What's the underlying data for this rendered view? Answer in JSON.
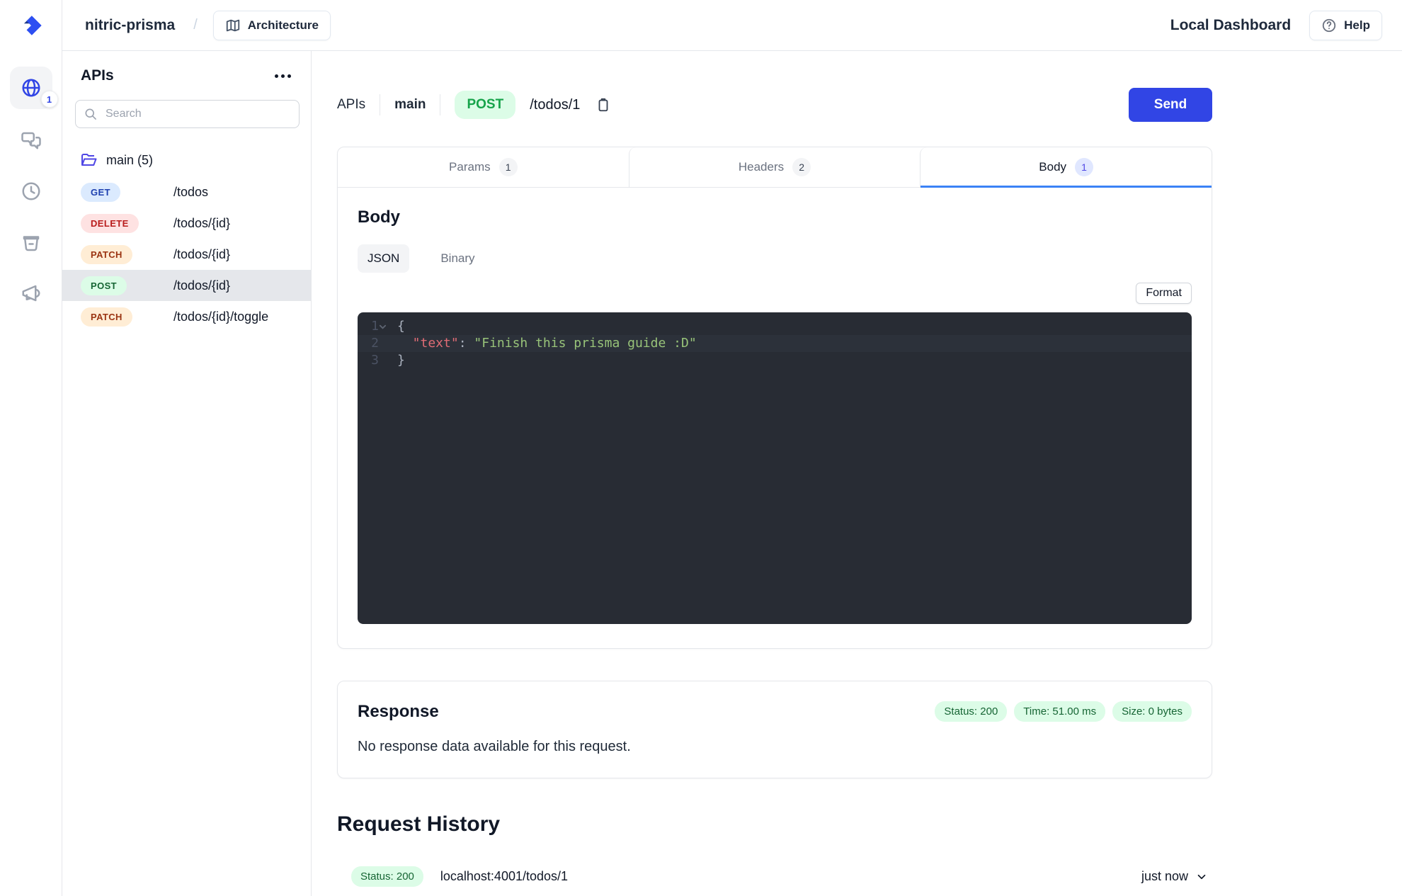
{
  "colors": {
    "accent": "#3145e5",
    "tab-underline": "#3b82f6",
    "editor-bg": "#282c34",
    "editor-line": "#2c313a",
    "code-key": "#e06c75",
    "code-string": "#98c379",
    "code-plain": "#abb2bf",
    "green-bg": "#dcfce7",
    "green-text": "#166534"
  },
  "header": {
    "project": "nitric-prisma",
    "separator": "/",
    "architecture": "Architecture",
    "local_dashboard": "Local Dashboard",
    "help": "Help"
  },
  "rail": {
    "apis_badge": "1"
  },
  "sidebar": {
    "title": "APIs",
    "search_placeholder": "Search",
    "folder": "main (5)",
    "routes": [
      {
        "method": "GET",
        "path": "/todos"
      },
      {
        "method": "DELETE",
        "path": "/todos/{id}"
      },
      {
        "method": "PATCH",
        "path": "/todos/{id}"
      },
      {
        "method": "POST",
        "path": "/todos/{id}"
      },
      {
        "method": "PATCH",
        "path": "/todos/{id}/toggle"
      }
    ]
  },
  "request": {
    "breadcrumb": {
      "root": "APIs",
      "api": "main",
      "method": "POST",
      "path": "/todos/1"
    },
    "send": "Send",
    "tabs": [
      {
        "label": "Params",
        "badge": "1"
      },
      {
        "label": "Headers",
        "badge": "2"
      },
      {
        "label": "Body",
        "badge": "1"
      }
    ],
    "body": {
      "heading": "Body",
      "modes": {
        "json": "JSON",
        "binary": "Binary"
      },
      "format": "Format",
      "code": {
        "line1": {
          "num": "1",
          "text": "{"
        },
        "line2": {
          "num": "2",
          "key": "  \"text\"",
          "colon": ": ",
          "value": "\"Finish this prisma guide :D\""
        },
        "line3": {
          "num": "3",
          "text": "}"
        }
      }
    }
  },
  "response": {
    "heading": "Response",
    "status": "Status: 200",
    "time": "Time: 51.00 ms",
    "size": "Size: 0 bytes",
    "empty": "No response data available for this request."
  },
  "history": {
    "heading": "Request History",
    "row": {
      "status": "Status: 200",
      "url": "localhost:4001/todos/1",
      "time": "just now"
    }
  }
}
